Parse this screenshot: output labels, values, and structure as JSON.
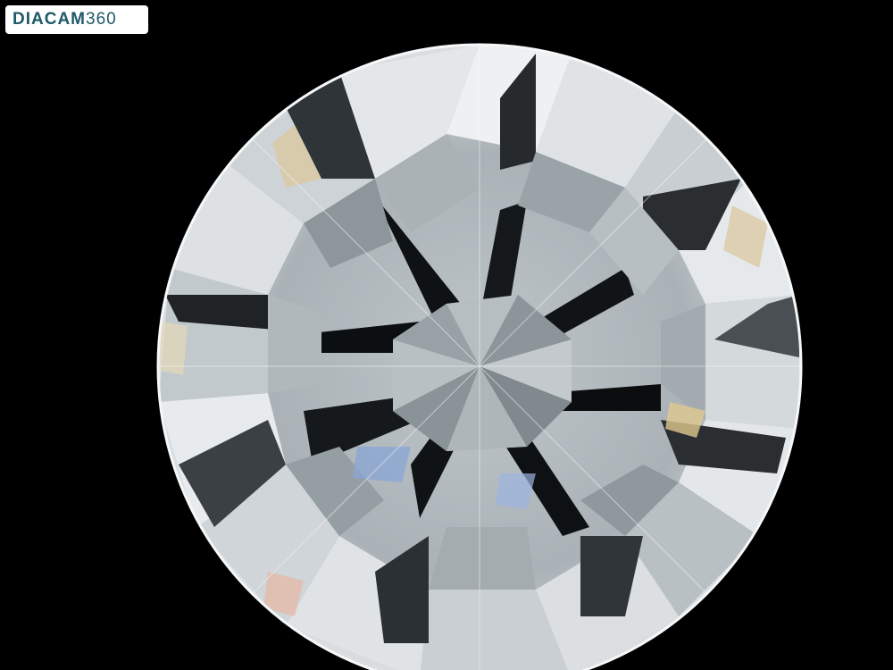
{
  "watermark": {
    "brand": "DIACAM",
    "suffix": "360"
  },
  "image": {
    "subject": "diamond-icon",
    "background_color": "#000000",
    "facet_colors": {
      "light": "#e8ecef",
      "mid": "#9aa3a8",
      "dark": "#3a3f43",
      "shadow": "#15181b",
      "warm": "#d8c9a6",
      "blue": "#8aa6d6"
    }
  }
}
